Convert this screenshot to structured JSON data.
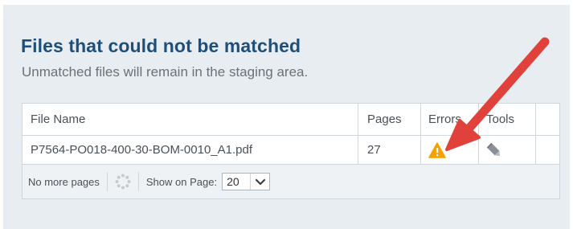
{
  "header": {
    "title": "Files that could not be matched",
    "subtitle": "Unmatched files will remain in the staging area."
  },
  "table": {
    "columns": [
      "File Name",
      "Pages",
      "Errors",
      "Tools"
    ],
    "rows": [
      {
        "file_name": "P7564-PO018-400-30-BOM-0010_A1.pdf",
        "pages": "27",
        "error_icon": "warning-icon",
        "tools_icon": "pencil-icon"
      }
    ]
  },
  "pager": {
    "no_more_pages": "No more pages",
    "loading_icon": "spinner-icon",
    "show_on_page_label": "Show on Page:",
    "page_size": "20"
  },
  "colors": {
    "title": "#1f4f78",
    "panel_background": "#e8edf2",
    "warning": "#f5a100",
    "annotation_arrow": "#e0413b"
  }
}
